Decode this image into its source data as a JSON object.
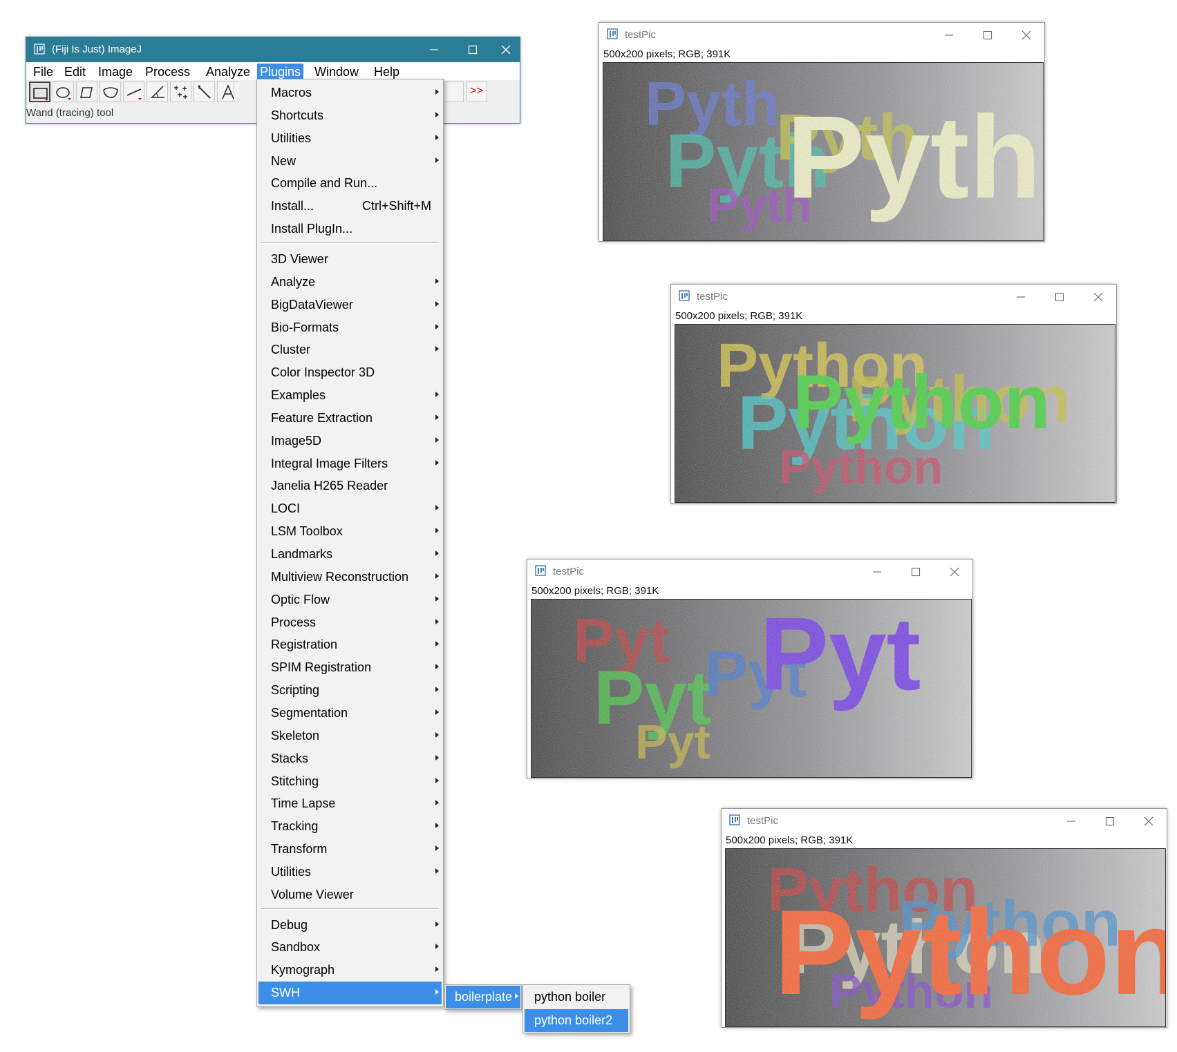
{
  "main_window": {
    "title": "(Fiji Is Just) ImageJ",
    "menus": [
      "File",
      "Edit",
      "Image",
      "Process",
      "Analyze",
      "Plugins",
      "Window",
      "Help"
    ],
    "active_menu": "Plugins",
    "status": "Wand (tracing) tool",
    "overflow_label": ">>"
  },
  "plugins_menu": {
    "group1": [
      {
        "label": "Macros",
        "submenu": true
      },
      {
        "label": "Shortcuts",
        "submenu": true
      },
      {
        "label": "Utilities",
        "submenu": true
      },
      {
        "label": "New",
        "submenu": true
      },
      {
        "label": "Compile and Run...",
        "submenu": false
      },
      {
        "label": "Install...",
        "shortcut": "Ctrl+Shift+M",
        "submenu": false
      },
      {
        "label": "Install PlugIn...",
        "submenu": false
      }
    ],
    "group2": [
      {
        "label": "3D Viewer",
        "submenu": false
      },
      {
        "label": "Analyze",
        "submenu": true
      },
      {
        "label": "BigDataViewer",
        "submenu": true
      },
      {
        "label": "Bio-Formats",
        "submenu": true
      },
      {
        "label": "Cluster",
        "submenu": true
      },
      {
        "label": "Color Inspector 3D",
        "submenu": false
      },
      {
        "label": "Examples",
        "submenu": true
      },
      {
        "label": "Feature Extraction",
        "submenu": true
      },
      {
        "label": "Image5D",
        "submenu": true
      },
      {
        "label": "Integral Image Filters",
        "submenu": true
      },
      {
        "label": "Janelia H265 Reader",
        "submenu": false
      },
      {
        "label": "LOCI",
        "submenu": true
      },
      {
        "label": "LSM Toolbox",
        "submenu": true
      },
      {
        "label": "Landmarks",
        "submenu": true
      },
      {
        "label": "Multiview Reconstruction",
        "submenu": true
      },
      {
        "label": "Optic Flow",
        "submenu": true
      },
      {
        "label": "Process",
        "submenu": true
      },
      {
        "label": "Registration",
        "submenu": true
      },
      {
        "label": "SPIM Registration",
        "submenu": true
      },
      {
        "label": "Scripting",
        "submenu": true
      },
      {
        "label": "Segmentation",
        "submenu": true
      },
      {
        "label": "Skeleton",
        "submenu": true
      },
      {
        "label": "Stacks",
        "submenu": true
      },
      {
        "label": "Stitching",
        "submenu": true
      },
      {
        "label": "Time Lapse",
        "submenu": true
      },
      {
        "label": "Tracking",
        "submenu": true
      },
      {
        "label": "Transform",
        "submenu": true
      },
      {
        "label": "Utilities",
        "submenu": true
      },
      {
        "label": "Volume Viewer",
        "submenu": false
      }
    ],
    "group3": [
      {
        "label": "Debug",
        "submenu": true
      },
      {
        "label": "Sandbox",
        "submenu": true
      },
      {
        "label": "Kymograph",
        "submenu": true
      },
      {
        "label": "SWH",
        "submenu": true,
        "highlighted": true
      }
    ]
  },
  "boilerplate_menu": {
    "label": "boilerplate"
  },
  "python_menu": {
    "items": [
      "python boiler",
      "python boiler2"
    ],
    "highlighted": "python boiler2"
  },
  "image_windows": [
    {
      "title": "testPic",
      "info": "500x200 pixels; RGB; 391K",
      "big_word": "Pyth",
      "big_color": "#f4f6c8"
    },
    {
      "title": "testPic",
      "info": "500x200 pixels; RGB; 391K",
      "big_word": "Python",
      "big_color": "#3fd23a"
    },
    {
      "title": "testPic",
      "info": "500x200 pixels; RGB; 391K",
      "big_word": "Pyt",
      "big_color": "#7038e8"
    },
    {
      "title": "testPic",
      "info": "500x200 pixels; RGB; 391K",
      "big_word": "Python",
      "big_color": "#ff5a26"
    }
  ],
  "colors": {
    "titlebar": "#2b7d96",
    "highlight": "#3c8ee8",
    "menu_bg": "#f2f2f2"
  }
}
